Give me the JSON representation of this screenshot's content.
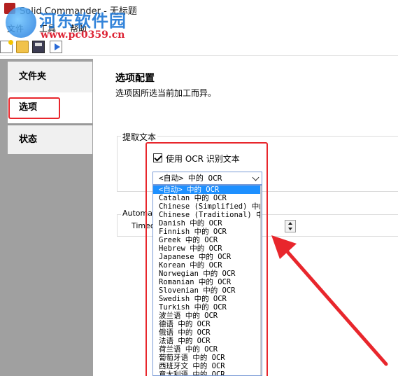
{
  "window": {
    "title": "Solid Commander - 无标题"
  },
  "watermark": {
    "name": "河东软件园",
    "url": "www.pc0359.cn"
  },
  "menu": {
    "file": "文件",
    "tools": "工具",
    "help": "帮助"
  },
  "sidebar": {
    "items": [
      {
        "label": "文件夹"
      },
      {
        "label": "选项"
      },
      {
        "label": "状态"
      }
    ]
  },
  "main": {
    "title": "选项配置",
    "description": "选项因所选当前加工而异。",
    "extract_group": "提取文本",
    "ocr_checkbox": "使用 OCR 识别文本",
    "ocr_combo_value": "<自动> 中的 OCR",
    "automate_group": "Automate",
    "timeout_label": "Timeo"
  },
  "dropdown": {
    "options": [
      "<自动> 中的 OCR",
      "Catalan 中的 OCR",
      "Chinese (Simplified) 中的",
      "Chinese (Traditional) 中的",
      "Danish 中的 OCR",
      "Finnish 中的 OCR",
      "Greek 中的 OCR",
      "Hebrew 中的 OCR",
      "Japanese 中的 OCR",
      "Korean 中的 OCR",
      "Norwegian 中的 OCR",
      "Romanian 中的 OCR",
      "Slovenian 中的 OCR",
      "Swedish 中的 OCR",
      "Turkish 中的 OCR",
      "波兰语 中的 OCR",
      "德语 中的 OCR",
      "俄语 中的 OCR",
      "法语 中的 OCR",
      "荷兰语 中的 OCR",
      "葡萄牙语 中的 OCR",
      "西班牙文 中的 OCR",
      "意大利语 中的 OCR"
    ]
  },
  "colors": {
    "annotation": "#e8262c",
    "selection": "#1e90ff"
  }
}
